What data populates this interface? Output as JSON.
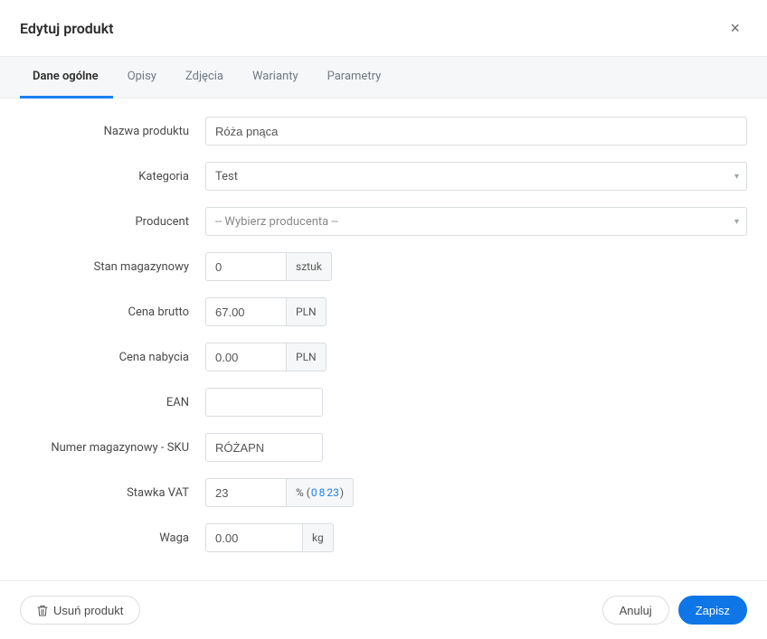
{
  "header": {
    "title": "Edytuj produkt"
  },
  "tabs": [
    {
      "label": "Dane ogólne",
      "active": true
    },
    {
      "label": "Opisy",
      "active": false
    },
    {
      "label": "Zdjęcia",
      "active": false
    },
    {
      "label": "Warianty",
      "active": false
    },
    {
      "label": "Parametry",
      "active": false
    }
  ],
  "form": {
    "name_label": "Nazwa produktu",
    "name_value": "Róża pnąca",
    "category_label": "Kategoria",
    "category_value": "Test",
    "producer_label": "Producent",
    "producer_value": "-- Wybierz producenta --",
    "stock_label": "Stan magazynowy",
    "stock_value": "0",
    "stock_unit": "sztuk",
    "price_gross_label": "Cena brutto",
    "price_gross_value": "67.00",
    "price_gross_unit": "PLN",
    "purchase_price_label": "Cena nabycia",
    "purchase_price_value": "0.00",
    "purchase_price_unit": "PLN",
    "ean_label": "EAN",
    "ean_value": "",
    "sku_label": "Numer magazynowy - SKU",
    "sku_value": "RÓŻAPN",
    "vat_label": "Stawka VAT",
    "vat_value": "23",
    "vat_unit_prefix": "% (",
    "vat_opt_0": "0",
    "vat_opt_8": "8",
    "vat_opt_23": "23",
    "vat_unit_suffix": ")",
    "weight_label": "Waga",
    "weight_value": "0.00",
    "weight_unit": "kg"
  },
  "footer": {
    "delete_label": "Usuń produkt",
    "cancel_label": "Anuluj",
    "save_label": "Zapisz"
  }
}
